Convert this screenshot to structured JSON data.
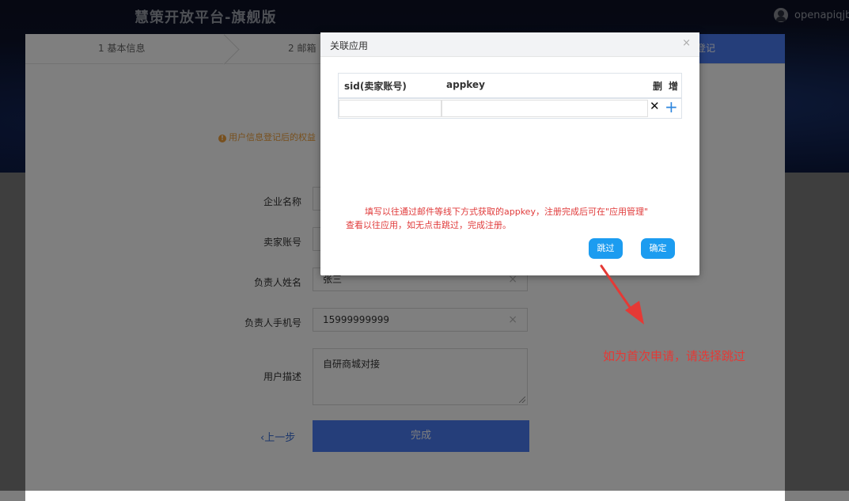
{
  "header": {
    "brand": "慧策开放平台-旗舰版",
    "username": "openapiqjb"
  },
  "steps": {
    "step1": "1 基本信息",
    "step2": "2 邮箱",
    "active_suffix": "登记"
  },
  "notice": "用户信息登记后的权益",
  "form": {
    "company_label": "企业名称",
    "seller_label": "卖家账号",
    "owner_label": "负责人姓名",
    "owner_value": "张三",
    "phone_label": "负责人手机号",
    "phone_value": "15999999999",
    "desc_label": "用户描述",
    "desc_value": "自研商城对接",
    "prev_label": "上一步",
    "finish_label": "完成",
    "clear_icon": "×"
  },
  "modal": {
    "title": "关联应用",
    "close": "×",
    "col_sid": "sid(卖家账号)",
    "col_appkey": "appkey",
    "col_delete": "删",
    "col_add": "增",
    "row_delete_icon": "✕",
    "row_add_icon": "+",
    "hint_line1": "填写以往通过邮件等线下方式获取的appkey，注册完成后可在\"应用管理\"",
    "hint_line2": "查看以往应用，如无点击跳过，完成注册。",
    "skip_label": "跳过",
    "confirm_label": "确定"
  },
  "annotation": {
    "text": "如为首次申请，请选择跳过",
    "color": "#e53935"
  },
  "colors": {
    "primary": "#4b7cf5",
    "modal_button": "#1c9cf0",
    "warning": "#f0a13c"
  }
}
